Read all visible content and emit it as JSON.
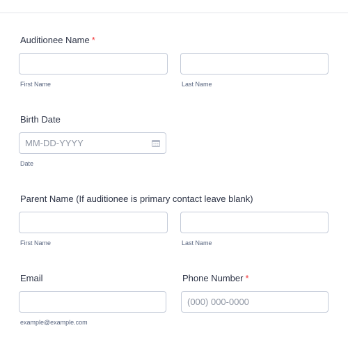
{
  "fields": {
    "auditionee_name": {
      "label": "Auditionee Name",
      "required_mark": "*",
      "first_value": "",
      "last_value": "",
      "first_sublabel": "First Name",
      "last_sublabel": "Last Name"
    },
    "birth_date": {
      "label": "Birth Date",
      "placeholder": "MM-DD-YYYY",
      "value": "",
      "sublabel": "Date",
      "icon": "calendar-icon"
    },
    "parent_name": {
      "label": "Parent Name (If auditionee is primary contact leave blank)",
      "first_value": "",
      "last_value": "",
      "first_sublabel": "First Name",
      "last_sublabel": "Last Name"
    },
    "email": {
      "label": "Email",
      "value": "",
      "sublabel": "example@example.com"
    },
    "phone": {
      "label": "Phone Number",
      "required_mark": "*",
      "placeholder": "(000) 000-0000",
      "value": ""
    }
  },
  "colors": {
    "required": "#f23a3c",
    "border": "#c3cad8",
    "text": "#2c3345",
    "sublabel": "#57647e"
  }
}
